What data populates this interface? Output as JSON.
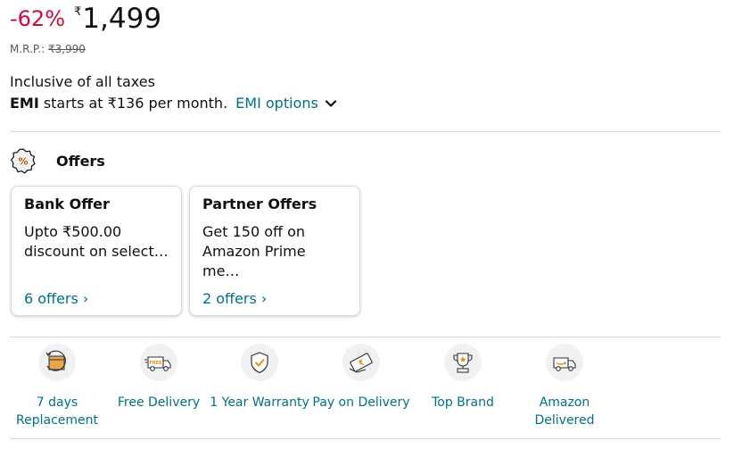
{
  "price": {
    "discount": "-62%",
    "currency": "₹",
    "amount": "1,499"
  },
  "mrp": {
    "label": "M.R.P.:",
    "value": "₹3,990"
  },
  "taxes_text": "Inclusive of all taxes",
  "emi": {
    "bold": "EMI",
    "text": "starts at ₹136 per month.",
    "link": "EMI options"
  },
  "offers": {
    "title": "Offers",
    "cards": [
      {
        "title": "Bank Offer",
        "desc": "Upto ₹500.00\ndiscount on select…",
        "more": "6 offers ›"
      },
      {
        "title": "Partner Offers",
        "desc": "Get 150 off on\nAmazon Prime me…",
        "more": "2 offers ›"
      }
    ]
  },
  "features": [
    {
      "label": "7 days Replacement",
      "icon": "replacement-icon"
    },
    {
      "label": "Free Delivery",
      "icon": "free-delivery-truck-icon"
    },
    {
      "label": "1 Year Warranty",
      "icon": "warranty-shield-icon"
    },
    {
      "label": "Pay on Delivery",
      "icon": "pay-on-delivery-icon"
    },
    {
      "label": "Top Brand",
      "icon": "top-brand-trophy-icon"
    },
    {
      "label": "Amazon Delivered",
      "icon": "amazon-delivered-van-icon"
    }
  ]
}
